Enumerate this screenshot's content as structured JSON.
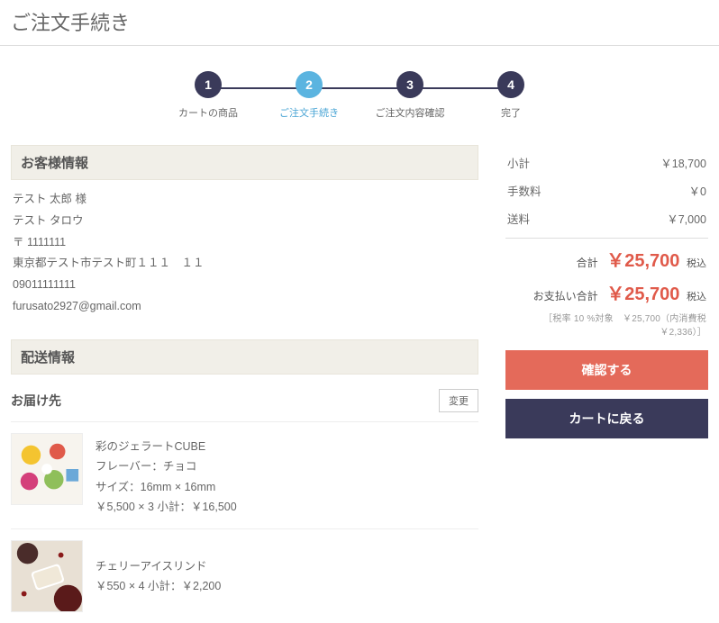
{
  "page_title": "ご注文手続き",
  "steps": [
    {
      "num": "1",
      "label": "カートの商品"
    },
    {
      "num": "2",
      "label": "ご注文手続き"
    },
    {
      "num": "3",
      "label": "ご注文内容確認"
    },
    {
      "num": "4",
      "label": "完了"
    }
  ],
  "active_step": 1,
  "customer": {
    "heading": "お客様情報",
    "name": "テスト 太郎 様",
    "kana": "テスト タロウ",
    "postal": "〒 1111111",
    "address": "東京都テスト市テスト町１１１　１１",
    "phone": "09011111111",
    "email": "furusato2927@gmail.com"
  },
  "shipping": {
    "heading": "配送情報",
    "sub_heading": "お届け先",
    "change_label": "変更"
  },
  "items": [
    {
      "name": "彩のジェラートCUBE",
      "opt1": "フレーバー：チョコ",
      "opt2": "サイズ：16mm × 16mm",
      "price_line": "￥5,500 × 3  小計：￥16,500"
    },
    {
      "name": "チェリーアイスリンド",
      "price_line": "￥550 × 4  小計：￥2,200"
    }
  ],
  "totals": {
    "subtotal_label": "小計",
    "subtotal_value": "￥18,700",
    "fee_label": "手数料",
    "fee_value": "￥0",
    "ship_label": "送料",
    "ship_value": "￥7,000",
    "grand_label": "合計",
    "grand_value": "￥25,700",
    "grand_tax": "税込",
    "pay_label": "お支払い合計",
    "pay_value": "￥25,700",
    "pay_tax": "税込",
    "note": "［税率 10 %対象　￥25,700（内消費税 ￥2,336）］"
  },
  "buttons": {
    "confirm": "確認する",
    "back": "カートに戻る"
  }
}
